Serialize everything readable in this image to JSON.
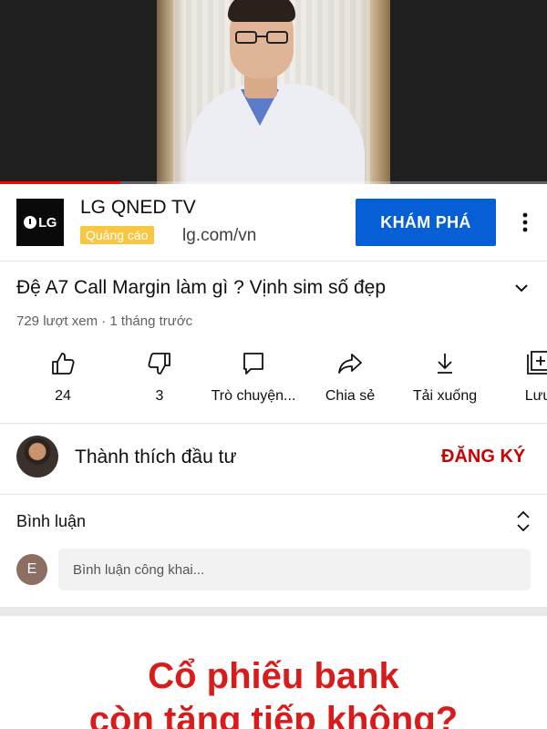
{
  "video_player": {
    "progress": 0.22,
    "progress_color": "#ff0000"
  },
  "ad": {
    "title": "LG QNED TV",
    "badge": "Quảng cáo",
    "domain": "lg.com/vn",
    "cta_label": "KHÁM PHÁ",
    "logo_text": "LG",
    "cta_color": "#065fd4",
    "badge_color": "#f7c744"
  },
  "video": {
    "title": "Đệ A7 Call Margin làm gì ? Vịnh sim số đẹp",
    "meta": "729 lượt xem · 1 tháng trước"
  },
  "actions": [
    {
      "icon": "thumbs-up-icon",
      "label": "24"
    },
    {
      "icon": "thumbs-down-icon",
      "label": "3"
    },
    {
      "icon": "chat-icon",
      "label": "Trò chuyện..."
    },
    {
      "icon": "share-icon",
      "label": "Chia sẻ"
    },
    {
      "icon": "download-icon",
      "label": "Tải xuống"
    },
    {
      "icon": "save-playlist-icon",
      "label": "Lưu"
    }
  ],
  "channel": {
    "name": "Thành thích đầu tư",
    "subscribe_label": "ĐĂNG KÝ",
    "subscribe_color": "#cc0000"
  },
  "comments": {
    "title": "Bình luận",
    "avatar_letter": "E",
    "placeholder": "Bình luận công khai..."
  },
  "next_video": {
    "line1": "Cổ phiếu bank",
    "line2": "còn tăng tiếp không?"
  }
}
